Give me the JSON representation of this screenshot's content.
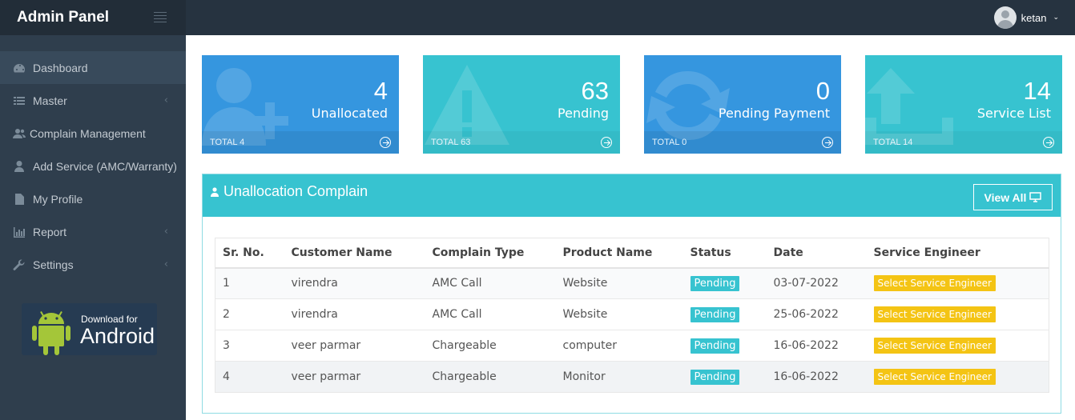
{
  "header": {
    "title": "Admin Panel",
    "user_name": "ketan"
  },
  "sidebar": {
    "items": [
      {
        "label": "Dashboard",
        "icon": "dashboard-icon",
        "active": true
      },
      {
        "label": "Master",
        "icon": "list-icon",
        "expandable": true
      },
      {
        "label": "Complain Management",
        "icon": "users-icon"
      },
      {
        "label": "Add Service (AMC/Warranty)",
        "icon": "user-icon"
      },
      {
        "label": "My Profile",
        "icon": "file-icon"
      },
      {
        "label": "Report",
        "icon": "bar-chart-icon",
        "expandable": true
      },
      {
        "label": "Settings",
        "icon": "wrench-icon",
        "expandable": true
      }
    ],
    "android_badge": {
      "line1": "Download for",
      "line2": "Android"
    }
  },
  "stats": [
    {
      "value": "4",
      "label": "Unallocated",
      "footer": "TOTAL 4",
      "color": "#3596df",
      "icon": "user-plus-icon"
    },
    {
      "value": "63",
      "label": "Pending",
      "footer": "TOTAL 63",
      "color": "#37c3d0",
      "icon": "warning-icon"
    },
    {
      "value": "0",
      "label": "Pending Payment",
      "footer": "TOTAL 0",
      "color": "#3596df",
      "icon": "refresh-icon"
    },
    {
      "value": "14",
      "label": "Service List",
      "footer": "TOTAL 14",
      "color": "#37c3d0",
      "icon": "upload-icon"
    }
  ],
  "panel": {
    "title": "Unallocation Complain",
    "view_all_label": "View All"
  },
  "table": {
    "columns": [
      "Sr. No.",
      "Customer Name",
      "Complain Type",
      "Product Name",
      "Status",
      "Date",
      "Service Engineer"
    ],
    "rows": [
      {
        "sr": "1",
        "customer": "virendra",
        "type": "AMC Call",
        "product": "Website",
        "status": "Pending",
        "date": "03-07-2022",
        "action": "Select Service Engineer"
      },
      {
        "sr": "2",
        "customer": "virendra",
        "type": "AMC Call",
        "product": "Website",
        "status": "Pending",
        "date": "25-06-2022",
        "action": "Select Service Engineer"
      },
      {
        "sr": "3",
        "customer": "veer parmar",
        "type": "Chargeable",
        "product": "computer",
        "status": "Pending",
        "date": "16-06-2022",
        "action": "Select Service Engineer"
      },
      {
        "sr": "4",
        "customer": "veer parmar",
        "type": "Chargeable",
        "product": "Monitor",
        "status": "Pending",
        "date": "16-06-2022",
        "action": "Select Service Engineer"
      }
    ]
  },
  "colors": {
    "sidebar_bg": "#2f3e4d",
    "header_bg": "#263340",
    "stat_blue": "#3596df",
    "stat_teal": "#37c3d0",
    "status_badge": "#37c3d0",
    "engineer_button": "#f4c414"
  }
}
